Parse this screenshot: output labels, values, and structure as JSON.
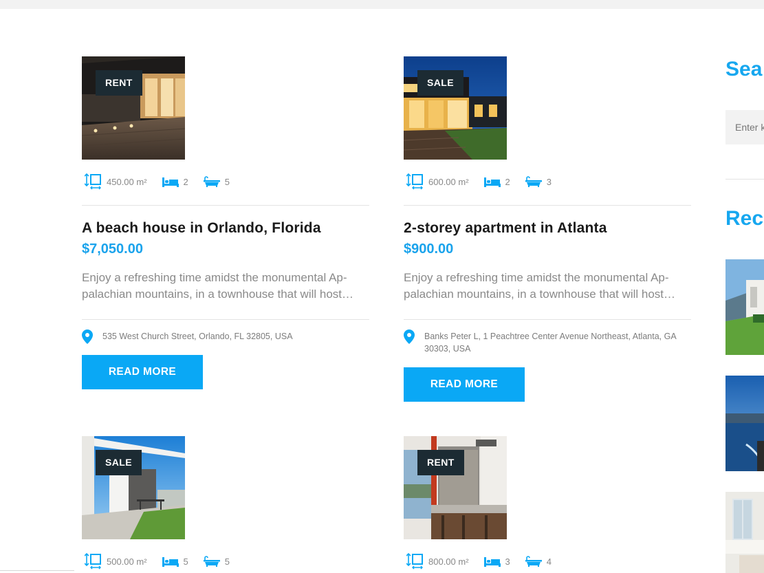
{
  "listings": [
    {
      "badge": "RENT",
      "area": "450.00 m²",
      "bedrooms": "2",
      "bathrooms": "5",
      "title": "A beach house in Orlando, Florida",
      "price": "$7,050.00",
      "excerpt_line1": "Enjoy a refreshing time amidst the monumental Ap-",
      "excerpt_line2": "palachian mountains, in a townhouse that will host…",
      "address": "535 West Church Street, Orlando, FL 32805, USA",
      "button": "READ MORE"
    },
    {
      "badge": "SALE",
      "area": "600.00 m²",
      "bedrooms": "2",
      "bathrooms": "3",
      "title": "2-storey apartment in Atlanta",
      "price": "$900.00",
      "excerpt_line1": "Enjoy a refreshing time amidst the monumental Ap-",
      "excerpt_line2": "palachian mountains, in a townhouse that will host…",
      "address": "Banks Peter L, 1 Peachtree Center Avenue Northeast, Atlanta, GA 30303, USA",
      "button": "READ MORE"
    },
    {
      "badge": "SALE",
      "area": "500.00 m²",
      "bedrooms": "5",
      "bathrooms": "5"
    },
    {
      "badge": "RENT",
      "area": "800.00 m²",
      "bedrooms": "3",
      "bathrooms": "4"
    }
  ],
  "sidebar": {
    "search_heading": "Sea",
    "search_placeholder": "Enter k",
    "recent_heading": "Rec"
  },
  "colors": {
    "accent": "#0aa8f5",
    "badge_bg": "#1c2b33",
    "heading": "#1a1a1a",
    "muted": "#8a8a8a"
  },
  "icons": [
    "area-icon",
    "bed-icon",
    "bath-icon",
    "location-pin-icon"
  ]
}
